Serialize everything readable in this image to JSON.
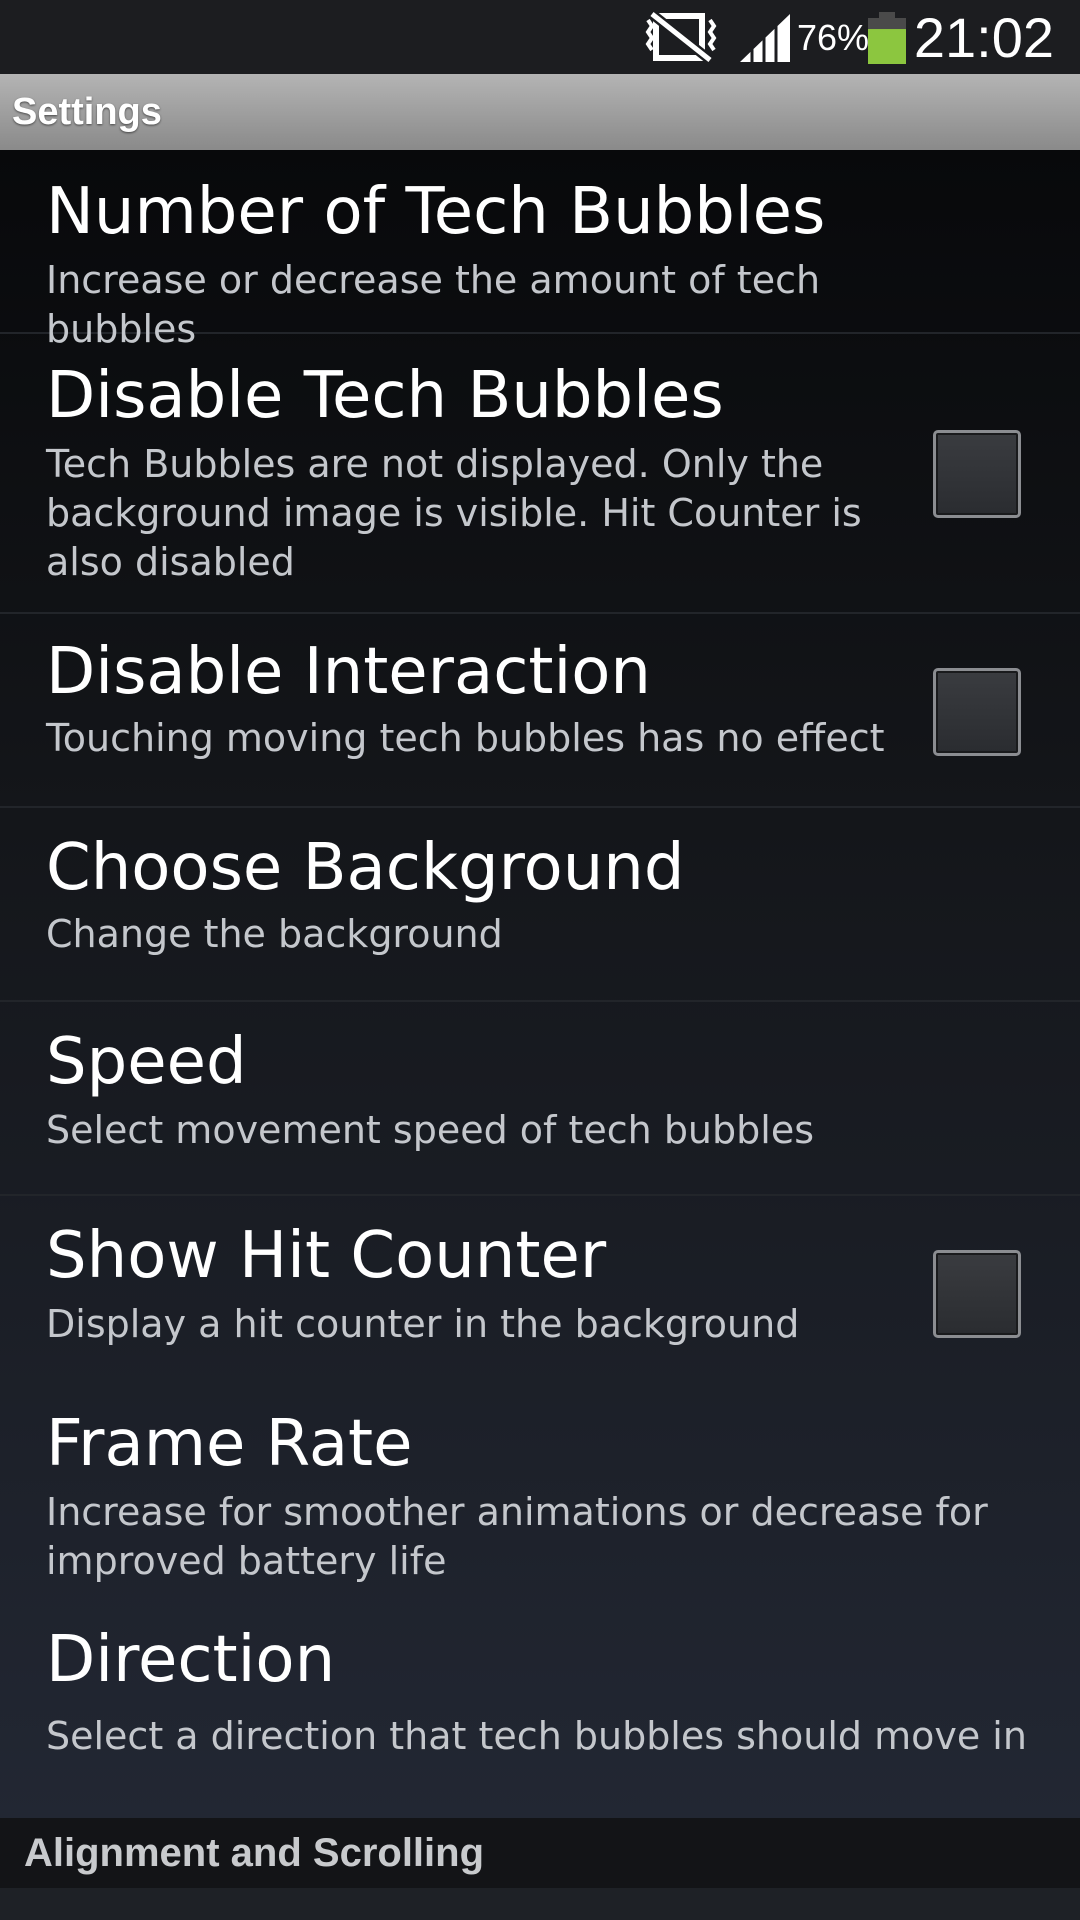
{
  "status_bar": {
    "battery_percent": "76%",
    "time": "21:02",
    "icons": [
      "mute-vibrate-icon",
      "signal-icon",
      "battery-icon"
    ],
    "battery_color": "#8cc63f"
  },
  "header": {
    "title": "Settings"
  },
  "preferences": [
    {
      "title": "Number of Tech Bubbles",
      "summary": "Increase or decrease the amount of tech bubbles",
      "has_checkbox": false
    },
    {
      "title": "Disable Tech Bubbles",
      "summary": "Tech Bubbles are not displayed. Only the background image is visible. Hit Counter is also disabled",
      "has_checkbox": true,
      "checked": false
    },
    {
      "title": "Disable Interaction",
      "summary": "Touching moving tech bubbles has no effect",
      "has_checkbox": true,
      "checked": false
    },
    {
      "title": "Choose Background",
      "summary": "Change the background",
      "has_checkbox": false
    },
    {
      "title": "Speed",
      "summary": "Select movement speed of tech bubbles",
      "has_checkbox": false
    },
    {
      "title": "Show Hit Counter",
      "summary": "Display a hit counter in the background",
      "has_checkbox": true,
      "checked": false
    },
    {
      "title": "Frame Rate",
      "summary": "Increase for smoother animations or decrease for improved battery life",
      "has_checkbox": false
    },
    {
      "title": "Direction",
      "summary": "Select a direction that tech bubbles should move in",
      "has_checkbox": false
    }
  ],
  "category": {
    "title": "Alignment and Scrolling"
  }
}
